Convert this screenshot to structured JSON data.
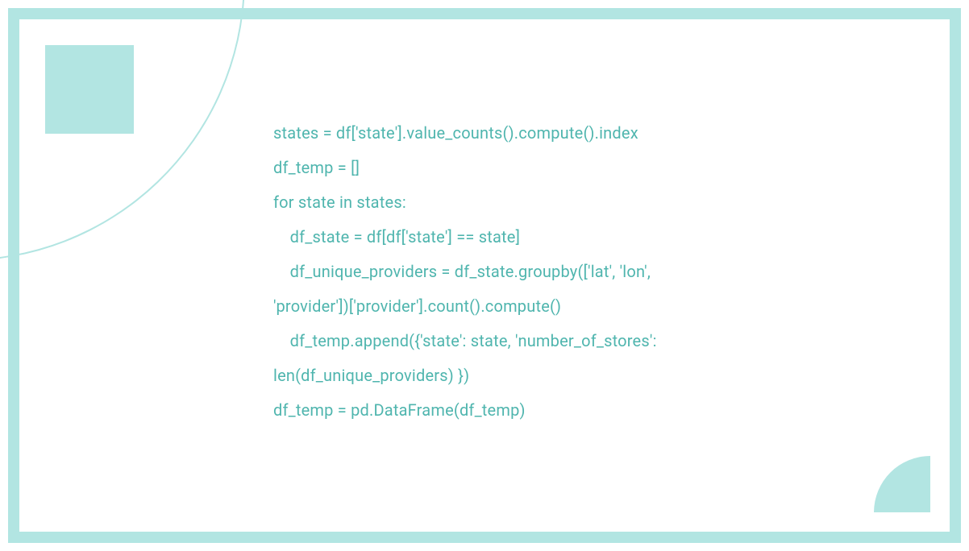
{
  "code": {
    "line1": "states = df['state'].value_counts().compute().index",
    "line2": "df_temp = []",
    "line3": "for state in states:",
    "line4": "    df_state = df[df['state'] == state]",
    "line5": "    df_unique_providers = df_state.groupby(['lat', 'lon', 'provider'])['provider'].count().compute()",
    "line6": "    df_temp.append({'state': state, 'number_of_stores': len(df_unique_providers) })",
    "line7": "df_temp = pd.DataFrame(df_temp)"
  },
  "colors": {
    "accent": "#b2e5e2",
    "text": "#4fb5ae"
  }
}
